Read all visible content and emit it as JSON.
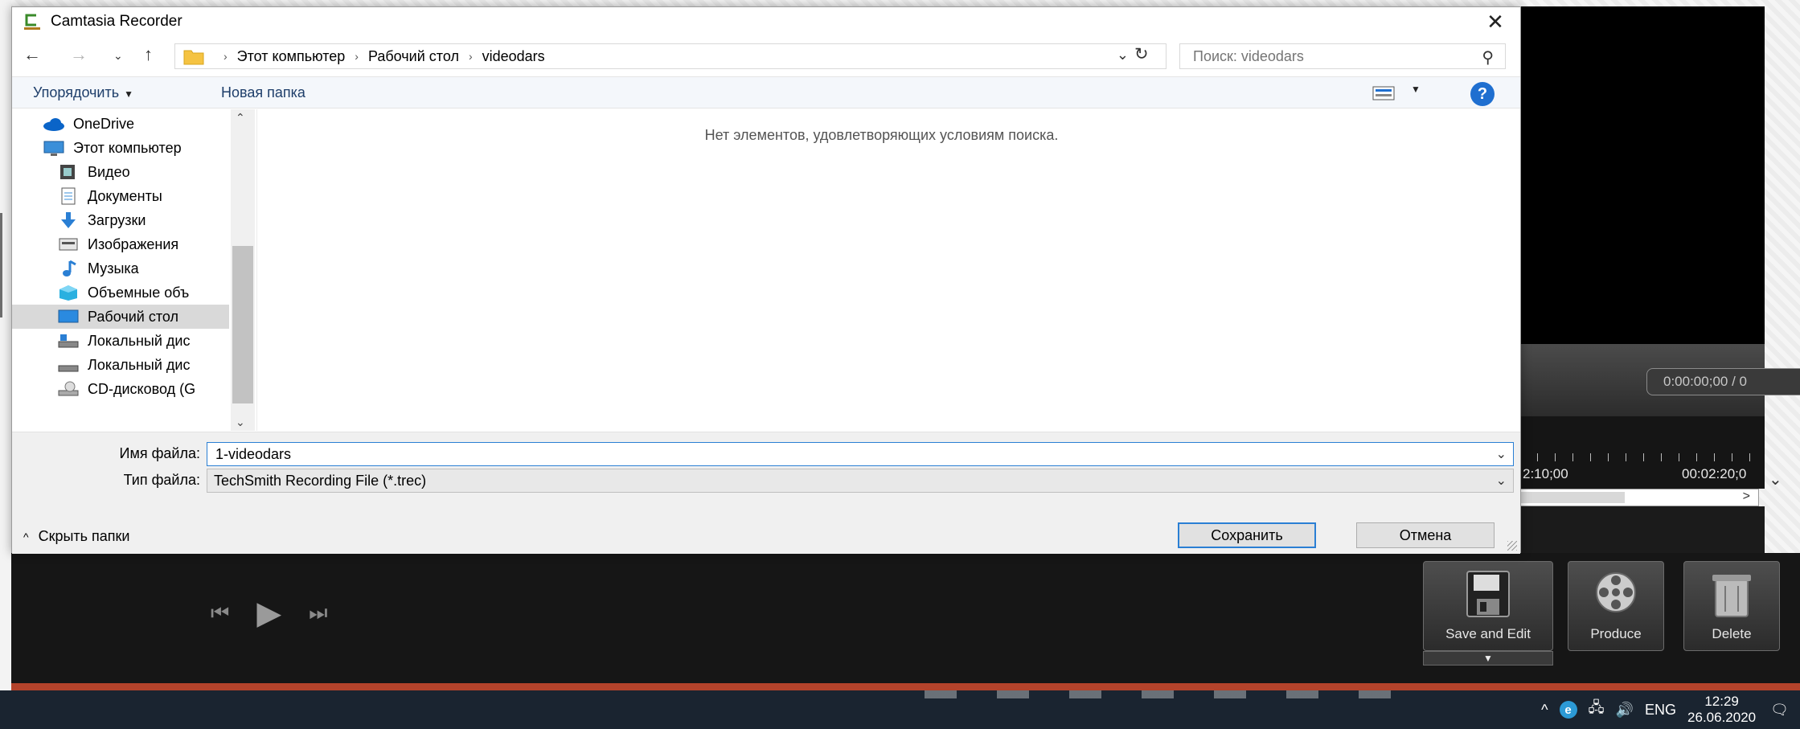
{
  "window": {
    "title": "Camtasia Recorder"
  },
  "navigation": {
    "breadcrumb": [
      "Этот компьютер",
      "Рабочий стол",
      "videodars"
    ],
    "search_placeholder": "Поиск: videodars"
  },
  "commands": {
    "organize": "Упорядочить",
    "new_folder": "Новая папка"
  },
  "nav_pane": {
    "items": [
      {
        "label": "OneDrive",
        "icon": "cloud-icon"
      },
      {
        "label": "Этот компьютер",
        "icon": "computer-icon"
      },
      {
        "label": "Видео",
        "icon": "video-icon"
      },
      {
        "label": "Документы",
        "icon": "documents-icon"
      },
      {
        "label": "Загрузки",
        "icon": "download-icon"
      },
      {
        "label": "Изображения",
        "icon": "pictures-icon"
      },
      {
        "label": "Музыка",
        "icon": "music-icon"
      },
      {
        "label": "Объемные объ",
        "icon": "3d-objects-icon"
      },
      {
        "label": "Рабочий стол",
        "icon": "desktop-icon",
        "selected": true
      },
      {
        "label": "Локальный дис",
        "icon": "local-disk-icon"
      },
      {
        "label": "Локальный дис",
        "icon": "local-disk-icon"
      },
      {
        "label": "CD-дисковод (G",
        "icon": "cd-drive-icon"
      }
    ]
  },
  "content": {
    "empty_message": "Нет элементов, удовлетворяющих условиям поиска."
  },
  "form": {
    "filename_label": "Имя файла:",
    "filename_value": "1-videodars",
    "filetype_label": "Тип файла:",
    "filetype_value": "TechSmith Recording File (*.trec)",
    "hide_folders": "Скрыть папки",
    "save": "Сохранить",
    "cancel": "Отмена"
  },
  "camtasia": {
    "time_display": "0:00:00;00 / 0",
    "ruler_labels": [
      "2:10;00",
      "00:02:20;0"
    ],
    "buttons": {
      "save_edit": "Save and Edit",
      "produce": "Produce",
      "delete": "Delete"
    }
  },
  "taskbar": {
    "language": "ENG",
    "time": "12:29",
    "date": "26.06.2020"
  },
  "colors": {
    "accent": "#2a7fd4",
    "help": "#1f6fd0",
    "taskbar": "#1a2430",
    "camtasia_red": "#b4432b"
  }
}
